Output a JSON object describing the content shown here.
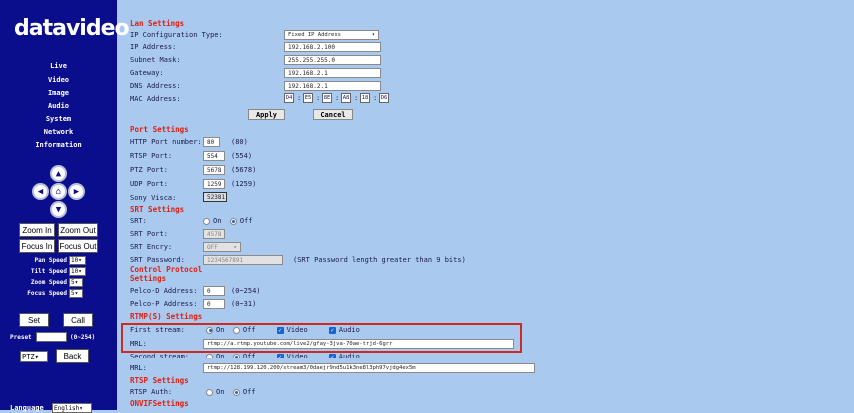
{
  "logo": "datavideo",
  "nav": [
    "Live",
    "Video",
    "Image",
    "Audio",
    "System",
    "Network",
    "Information"
  ],
  "camera": {
    "zoom_in": "Zoom In",
    "zoom_out": "Zoom Out",
    "focus_in": "Focus In",
    "focus_out": "Focus Out",
    "pan_speed_label": "Pan Speed",
    "pan_speed": "10",
    "tilt_speed_label": "Tilt Speed",
    "tilt_speed": "10",
    "zoom_speed_label": "Zoom Speed",
    "zoom_speed": "5",
    "focus_speed_label": "Focus Speed",
    "focus_speed": "5",
    "set": "Set",
    "call": "Call",
    "preset_label": "Preset",
    "preset_range": "(0~254)",
    "ptz": "PTZ",
    "back": "Back",
    "language_label": "Language",
    "language": "English"
  },
  "lan": {
    "title": "Lan Settings",
    "ip_config_label": "IP Configuration Type:",
    "ip_config": "Fixed IP Address",
    "ip_label": "IP Address:",
    "ip": "192.168.2.100",
    "mask_label": "Subnet Mask:",
    "mask": "255.255.255.0",
    "gateway_label": "Gateway:",
    "gateway": "192.168.2.1",
    "dns_label": "DNS Address:",
    "dns": "192.168.2.1",
    "mac_label": "MAC Address:",
    "mac": [
      "D4",
      "E5",
      "8E",
      "A8",
      "18",
      "D6"
    ],
    "apply": "Apply",
    "cancel": "Cancel"
  },
  "port": {
    "title": "Port Settings",
    "http_label": "HTTP Port number:",
    "http": "80",
    "http_default": "(80)",
    "rtsp_label": "RTSP Port:",
    "rtsp": "554",
    "rtsp_default": "(554)",
    "ptz_label": "PTZ Port:",
    "ptz": "5678",
    "ptz_default": "(5678)",
    "udp_label": "UDP Port:",
    "udp": "1259",
    "udp_default": "(1259)",
    "visca_label": "Sony Visca:",
    "visca": "52381"
  },
  "srt": {
    "title": "SRT Settings",
    "srt_label": "SRT:",
    "on": "On",
    "off": "Off",
    "port_label": "SRT Port:",
    "port": "4578",
    "encry_label": "SRT Encry:",
    "encry": "OFF",
    "pw_label": "SRT Password:",
    "pw": "1234567891",
    "pw_note": "(SRT Password length greater than 9 bits)"
  },
  "control": {
    "title1": "Control Protocol",
    "title2": "Settings",
    "pelcod_label": "Pelco-D Address:",
    "pelcod": "0",
    "pelcod_range": "(0~254)",
    "pelcop_label": "Pelco-P Address:",
    "pelcop": "0",
    "pelcop_range": "(0~31)"
  },
  "rtmp": {
    "title": "RTMP(S) Settings",
    "first_label": "First stream:",
    "on": "On",
    "off": "Off",
    "video": "Video",
    "audio": "Audio",
    "mrl_label": "MRL:",
    "mrl1": "rtmp://a.rtmp.youtube.com/live2/gfay-3jva-70ae-trjd-6grr",
    "second_label": "Second stream:",
    "mrl2": "rtmp://128.199.120.200/stream3/0daejr9nd5u1k3ne8l3ph97vjdg4ex5m"
  },
  "rtsp": {
    "title": "RTSP Settings",
    "auth_label": "RTSP Auth:",
    "on": "On",
    "off": "Off"
  },
  "onvif": {
    "title": "ONVIFSettings"
  }
}
